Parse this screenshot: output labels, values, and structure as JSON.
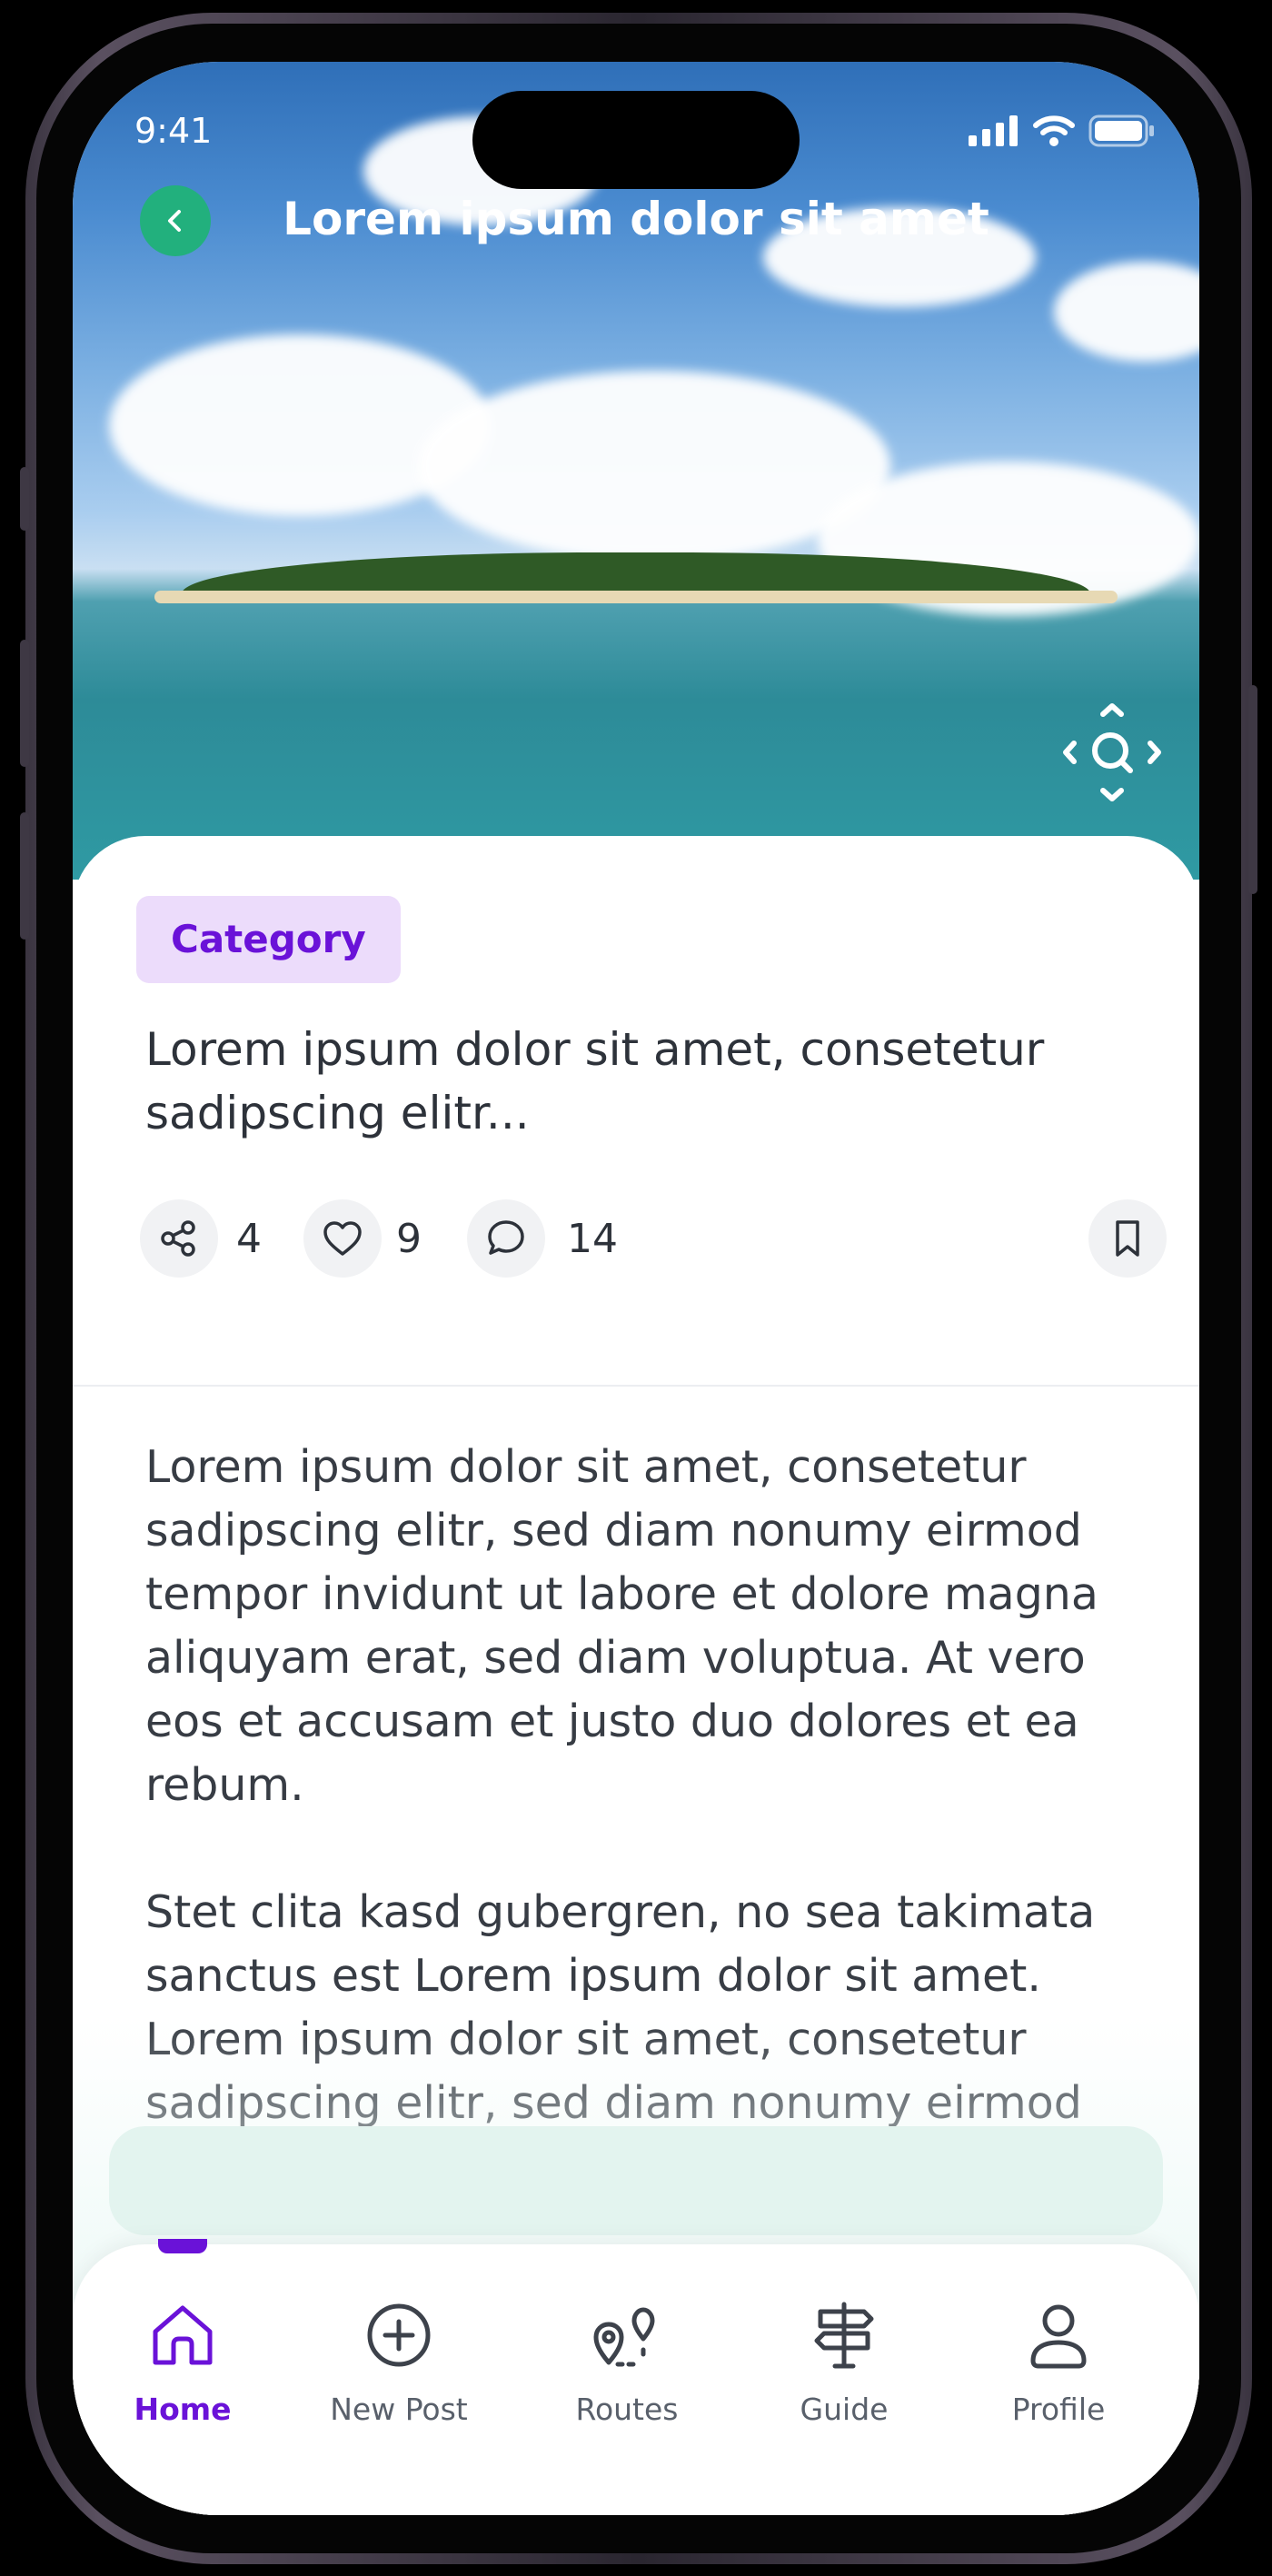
{
  "status_bar": {
    "time": "9:41"
  },
  "header": {
    "title": "Lorem ipsum dolor sit amet"
  },
  "post": {
    "category": "Category",
    "title": "Lorem ipsum dolor sit amet, consetetur sadipscing elitr...",
    "stats": {
      "shares": "4",
      "likes": "9",
      "comments": "14"
    },
    "paragraphs": [
      "Lorem ipsum dolor sit amet, consetetur sadipscing elitr, sed diam nonumy eirmod tempor invidunt ut labore et dolore magna aliquyam erat, sed diam voluptua. At vero eos et accusam et justo duo dolores et ea rebum.",
      "Stet clita kasd gubergren, no sea takimata sanctus est Lorem ipsum dolor sit amet. Lorem ipsum dolor sit amet, consetetur sadipscing elitr, sed diam nonumy eirmod tempor invidunt ut"
    ]
  },
  "tabbar": {
    "items": [
      {
        "label": "Home",
        "icon": "home-icon",
        "active": true
      },
      {
        "label": "New Post",
        "icon": "plus-circle-icon",
        "active": false
      },
      {
        "label": "Routes",
        "icon": "routes-icon",
        "active": false
      },
      {
        "label": "Guide",
        "icon": "signpost-icon",
        "active": false
      },
      {
        "label": "Profile",
        "icon": "user-icon",
        "active": false
      }
    ]
  },
  "colors": {
    "accent": "#6a12d8",
    "category_bg": "#ecdcfb",
    "back_button": "#22b07d",
    "text": "#2d323a"
  }
}
